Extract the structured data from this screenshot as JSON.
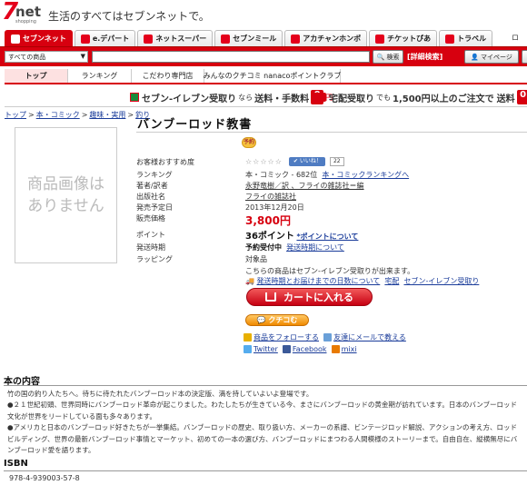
{
  "header": {
    "logo_text": "7net",
    "logo_sub": "shopping",
    "tagline": "生活のすべてはセブンネットで。"
  },
  "tabs": [
    {
      "label": "セブンネット",
      "active": true
    },
    {
      "label": "e.デパート"
    },
    {
      "label": "ネットスーパー"
    },
    {
      "label": "セブンミール"
    },
    {
      "label": "アカチャンホンポ"
    },
    {
      "label": "チケットぴあ"
    },
    {
      "label": "トラベル"
    }
  ],
  "tabs_extra": "ロ",
  "search": {
    "category": "すべての商品",
    "button": "検索",
    "advanced": "[詳細検索]",
    "mypage": "マイページ"
  },
  "subnav": [
    "トップ",
    "ランキング",
    "こだわり専門店",
    "みんなのクチコミ nanacoポイントクラブ"
  ],
  "promo": {
    "left_b1": "セブン-イレブン受取り",
    "left_s1": "なら",
    "left_b2": "送料・手数料",
    "zero": "0",
    "left_yen": "円",
    "right_b1": "宅配受取り",
    "right_s1": "でも",
    "right_b2": "1,500円以上のご注文で",
    "right_b3": "送料"
  },
  "breadcrumb": [
    "トップ",
    "本・コミック",
    "趣味・実用",
    "釣り"
  ],
  "product": {
    "image_placeholder": "商品画像は\nありません",
    "title": "バンブーロッド教書",
    "badge": "予約",
    "specs": {
      "rating_label": "お客様おすすめ度",
      "rating_stars": "☆☆☆☆☆",
      "iine": "いいね！",
      "iine_count": "22",
      "ranking_label": "ランキング",
      "ranking_value": "本・コミック - 682位",
      "ranking_link": "本・コミックランキングへ",
      "author_label": "著者/訳者",
      "author_value": "永野竜樹／訳 、フライの雑誌社＝編",
      "publisher_label": "出版社名",
      "publisher_value": "フライの雑誌社",
      "release_label": "発売予定日",
      "release_value": "2013年12月20日",
      "price_label": "販売価格",
      "price_value": "3,800円",
      "point_label": "ポイント",
      "point_value": "36ポイント",
      "point_link": "*ポイントについて",
      "ship_label": "発送時期",
      "ship_value": "予約受付中",
      "ship_link": "発送時期について",
      "wrapping_label": "ラッピング",
      "wrapping_value": "対象品",
      "store_note": "こちらの商品はセブン-イレブン受取りが出来ます。",
      "delivery_note": "発送時期とお届けまでの日数について",
      "delivery_link1": "宅配",
      "delivery_link2": "セブン-イレブン受取り"
    },
    "cart_button": "カートに入れる",
    "kuchikomu_button": "クチコむ",
    "follow": "商品をフォローする",
    "mail": "友達にメールで教える",
    "social": [
      "Twitter",
      "Facebook",
      "mixi"
    ]
  },
  "content": {
    "heading": "本の内容",
    "paragraphs": [
      "竹の国の釣り人たちへ。待ちに待たれたバンブーロッド本の決定版、満を持していよいよ登場です。",
      "●２１世紀初頭、世界同時にバンブーロッド革命が起こりました。わたしたちが生きている今、まさにバンブーロッドの黄金期が訪れています。日本のバンブーロッド文化が世界をリードしている面も多々あります。",
      "●アメリカと日本のバンブーロッド好きたちが一挙集結。バンブーロッドの歴史、取り扱い方、メーカーの系譜、ビンテージロッド解説、アクションの考え方、ロッドビルディング、世界の最新バンブーロッド事情とマーケット、初めての一本の選び方、バンブーロッドにまつわる人間模様のストーリーまで。自由自在、縦横無尽にバンブーロッド愛を語ります。"
    ],
    "isbn_heading": "ISBN",
    "isbn_value": "978-4-939003-57-8"
  }
}
